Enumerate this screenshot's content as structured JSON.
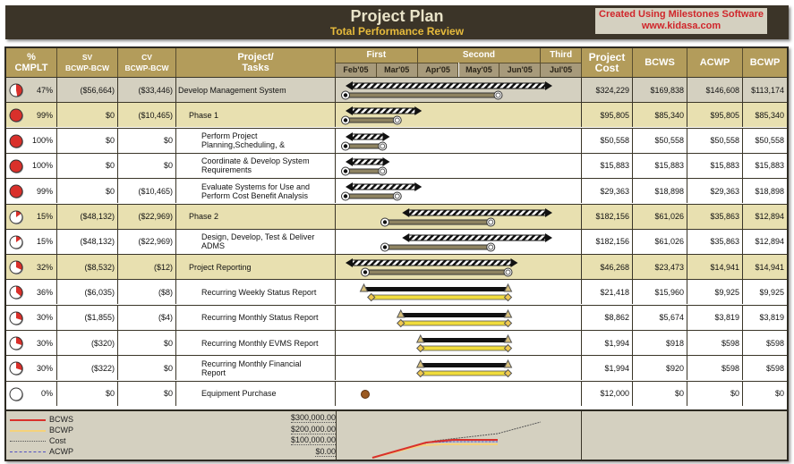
{
  "header": {
    "title": "Project Plan",
    "subtitle": "Total Performance Review",
    "promo_line1": "Created Using Milestones Software",
    "promo_line2": "www.kidasa.com"
  },
  "columns": {
    "pct": "%\nCMPLT",
    "pct_l1": "%",
    "pct_l2": "CMPLT",
    "sv_l1": "SV",
    "sv_l2": "BCWP-BCW",
    "cv_l1": "CV",
    "cv_l2": "BCWP-BCW",
    "task_l1": "Project/",
    "task_l2": "Tasks",
    "cost_l1": "Project",
    "cost_l2": "Cost",
    "bcws": "BCWS",
    "acwp": "ACWP",
    "bcwp": "BCWP"
  },
  "timeline": {
    "quarters": [
      {
        "label": "First",
        "months": 2
      },
      {
        "label": "Second",
        "months": 3
      },
      {
        "label": "Third",
        "months": 1
      }
    ],
    "months": [
      "Feb'05",
      "Mar'05",
      "Apr'05",
      "May'05",
      "Jun'05",
      "Jul'05"
    ]
  },
  "rows": [
    {
      "pct": "47%",
      "pct_value": 47,
      "sv": "($56,664)",
      "cv": "($33,446)",
      "task": "Develop Management System",
      "level": 0,
      "style": "top",
      "cost": "$324,229",
      "bcws": "$169,838",
      "acwp": "$146,608",
      "bcwp": "$113,174",
      "bar": "summary",
      "plan": [
        0.04,
        0.88
      ],
      "actual": [
        0.04,
        0.66
      ]
    },
    {
      "pct": "99%",
      "pct_value": 99,
      "sv": "$0",
      "cv": "($10,465)",
      "task": "Phase 1",
      "level": 1,
      "style": "phase",
      "cost": "$95,805",
      "bcws": "$85,340",
      "acwp": "$95,805",
      "bcwp": "$85,340",
      "bar": "summary",
      "plan": [
        0.04,
        0.35
      ],
      "actual": [
        0.04,
        0.25
      ]
    },
    {
      "pct": "100%",
      "pct_value": 100,
      "sv": "$0",
      "cv": "$0",
      "task": "Perform Project Planning,Scheduling, &",
      "level": 2,
      "style": "task",
      "cost": "$50,558",
      "bcws": "$50,558",
      "acwp": "$50,558",
      "bcwp": "$50,558",
      "bar": "summary",
      "plan": [
        0.04,
        0.22
      ],
      "actual": [
        0.04,
        0.19
      ]
    },
    {
      "pct": "100%",
      "pct_value": 100,
      "sv": "$0",
      "cv": "$0",
      "task": "Coordinate & Develop System Requirements",
      "level": 2,
      "style": "task",
      "cost": "$15,883",
      "bcws": "$15,883",
      "acwp": "$15,883",
      "bcwp": "$15,883",
      "bar": "summary",
      "plan": [
        0.04,
        0.22
      ],
      "actual": [
        0.04,
        0.19
      ]
    },
    {
      "pct": "99%",
      "pct_value": 99,
      "sv": "$0",
      "cv": "($10,465)",
      "task": "Evaluate Systems for Use and Perform Cost Benefit Analysis",
      "level": 2,
      "style": "task",
      "cost": "$29,363",
      "bcws": "$18,898",
      "acwp": "$29,363",
      "bcwp": "$18,898",
      "bar": "summary",
      "plan": [
        0.04,
        0.35
      ],
      "actual": [
        0.04,
        0.25
      ]
    },
    {
      "pct": "15%",
      "pct_value": 15,
      "sv": "($48,132)",
      "cv": "($22,969)",
      "task": "Phase 2",
      "level": 1,
      "style": "phase",
      "cost": "$182,156",
      "bcws": "$61,026",
      "acwp": "$35,863",
      "bcwp": "$12,894",
      "bar": "summary",
      "plan": [
        0.27,
        0.88
      ],
      "actual": [
        0.2,
        0.63
      ]
    },
    {
      "pct": "15%",
      "pct_value": 15,
      "sv": "($48,132)",
      "cv": "($22,969)",
      "task": "Design, Develop, Test & Deliver ADMS",
      "level": 2,
      "style": "task",
      "cost": "$182,156",
      "bcws": "$61,026",
      "acwp": "$35,863",
      "bcwp": "$12,894",
      "bar": "summary",
      "plan": [
        0.27,
        0.88
      ],
      "actual": [
        0.2,
        0.63
      ]
    },
    {
      "pct": "32%",
      "pct_value": 32,
      "sv": "($8,532)",
      "cv": "($12)",
      "task": "Project Reporting",
      "level": 1,
      "style": "phase",
      "cost": "$46,268",
      "bcws": "$23,473",
      "acwp": "$14,941",
      "bcwp": "$14,941",
      "bar": "summary",
      "plan": [
        0.04,
        0.74
      ],
      "actual": [
        0.12,
        0.7
      ]
    },
    {
      "pct": "36%",
      "pct_value": 36,
      "sv": "($6,035)",
      "cv": "($8)",
      "task": "Recurring Weekly Status Report",
      "level": 2,
      "style": "task",
      "cost": "$21,418",
      "bcws": "$15,960",
      "acwp": "$9,925",
      "bcwp": "$9,925",
      "bar": "recurring",
      "plan": [
        0.1,
        0.7
      ],
      "actual": [
        0.13,
        0.7
      ]
    },
    {
      "pct": "30%",
      "pct_value": 30,
      "sv": "($1,855)",
      "cv": "($4)",
      "task": "Recurring Monthly Status Report",
      "level": 2,
      "style": "task",
      "cost": "$8,862",
      "bcws": "$5,674",
      "acwp": "$3,819",
      "bcwp": "$3,819",
      "bar": "recurring",
      "plan": [
        0.25,
        0.7
      ],
      "actual": [
        0.25,
        0.7
      ]
    },
    {
      "pct": "30%",
      "pct_value": 30,
      "sv": "($320)",
      "cv": "$0",
      "task": "Recurring Monthly EVMS Report",
      "level": 2,
      "style": "task",
      "cost": "$1,994",
      "bcws": "$918",
      "acwp": "$598",
      "bcwp": "$598",
      "bar": "recurring",
      "plan": [
        0.33,
        0.7
      ],
      "actual": [
        0.33,
        0.7
      ]
    },
    {
      "pct": "30%",
      "pct_value": 30,
      "sv": "($322)",
      "cv": "$0",
      "task": "Recurring Monthly Financial Report",
      "level": 2,
      "style": "task",
      "cost": "$1,994",
      "bcws": "$920",
      "acwp": "$598",
      "bcwp": "$598",
      "bar": "recurring",
      "plan": [
        0.33,
        0.7
      ],
      "actual": [
        0.33,
        0.7
      ]
    },
    {
      "pct": "0%",
      "pct_value": 0,
      "sv": "$0",
      "cv": "$0",
      "task": "Equipment Purchase",
      "level": 2,
      "style": "task",
      "cost": "$12,000",
      "bcws": "$0",
      "acwp": "$0",
      "bcwp": "$0",
      "bar": "milestone",
      "plan": [
        0.12,
        0.12
      ],
      "actual": [
        0.12,
        0.12
      ]
    }
  ],
  "footer": {
    "legend": [
      {
        "label": "BCWS",
        "color": "#d9302b",
        "style": "solid"
      },
      {
        "label": "BCWP",
        "color": "#f5d27a",
        "style": "solid"
      },
      {
        "label": "Cost",
        "color": "#555555",
        "style": "dotted"
      },
      {
        "label": "ACWP",
        "color": "#5050c0",
        "style": "dashed"
      }
    ],
    "yaxis": [
      "$300,000.00",
      "$200,000.00",
      "$100,000.00",
      "$0.00"
    ]
  },
  "colors": {
    "header_bg": "#b39c5b",
    "title_bar": "#3b3428",
    "phase_row": "#e8e0b0",
    "top_row": "#d4d0c0",
    "promo_text": "#d0262b",
    "pie_fill": "#d9302b"
  }
}
